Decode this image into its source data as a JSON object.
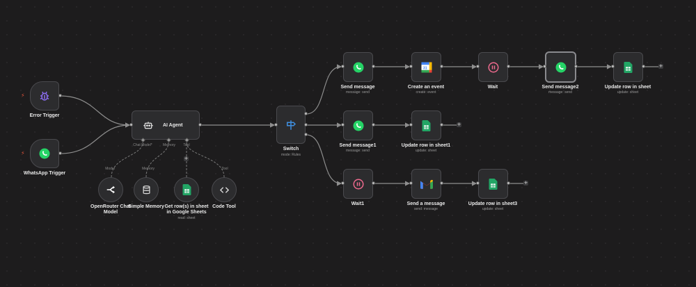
{
  "nodes": {
    "error_trigger": {
      "label": "Error Trigger"
    },
    "whatsapp_trigger": {
      "label": "WhatsApp Trigger"
    },
    "ai_agent": {
      "label": "AI Agent"
    },
    "openrouter": {
      "label_line1": "OpenRouter Chat",
      "label_line2": "Model"
    },
    "simple_memory": {
      "label": "Simple Memory"
    },
    "get_rows": {
      "label_line1": "Get row(s) in sheet",
      "label_line2": "in Google Sheets",
      "sublabel": "read: sheet"
    },
    "code_tool": {
      "label": "Code Tool"
    },
    "switch": {
      "label": "Switch",
      "sublabel": "mode: Rules"
    },
    "send_message": {
      "label": "Send message",
      "sublabel": "message: send"
    },
    "create_event": {
      "label": "Create an event",
      "sublabel": "create: event"
    },
    "wait": {
      "label": "Wait"
    },
    "send_message2": {
      "label": "Send message2",
      "sublabel": "message: send"
    },
    "update_row": {
      "label": "Update row in sheet",
      "sublabel": "update: sheet"
    },
    "send_message1": {
      "label": "Send message1",
      "sublabel": "message: send"
    },
    "update_row1": {
      "label": "Update row in sheet1",
      "sublabel": "update: sheet"
    },
    "wait1": {
      "label": "Wait1"
    },
    "send_a_message": {
      "label": "Send a message",
      "sublabel": "send: message"
    },
    "update_row3": {
      "label": "Update row in sheet3",
      "sublabel": "update: sheet"
    }
  },
  "agent_ports": {
    "chat_model": "Chat Model*",
    "memory": "Memory",
    "tool": "Tool"
  },
  "sub_connections": {
    "model": "Model",
    "memory": "Memory",
    "tool": "Tool"
  },
  "add_symbol": "+",
  "trigger_symbol": "⚡",
  "colors": {
    "background": "#1d1c1d",
    "node": "#2c2c2e",
    "edge": "#8e8e8e",
    "whatsapp": "#25d366",
    "sheets": "#22a565",
    "wait": "#ef6a8e",
    "switch": "#3f8fe0",
    "error": "#8b6cf0"
  },
  "icons": [
    "bug-icon",
    "whatsapp-icon",
    "robot-icon",
    "openrouter-icon",
    "database-icon",
    "google-sheets-icon",
    "code-icon",
    "signpost-icon",
    "google-calendar-icon",
    "pause-icon",
    "gmail-icon",
    "bolt-icon"
  ]
}
